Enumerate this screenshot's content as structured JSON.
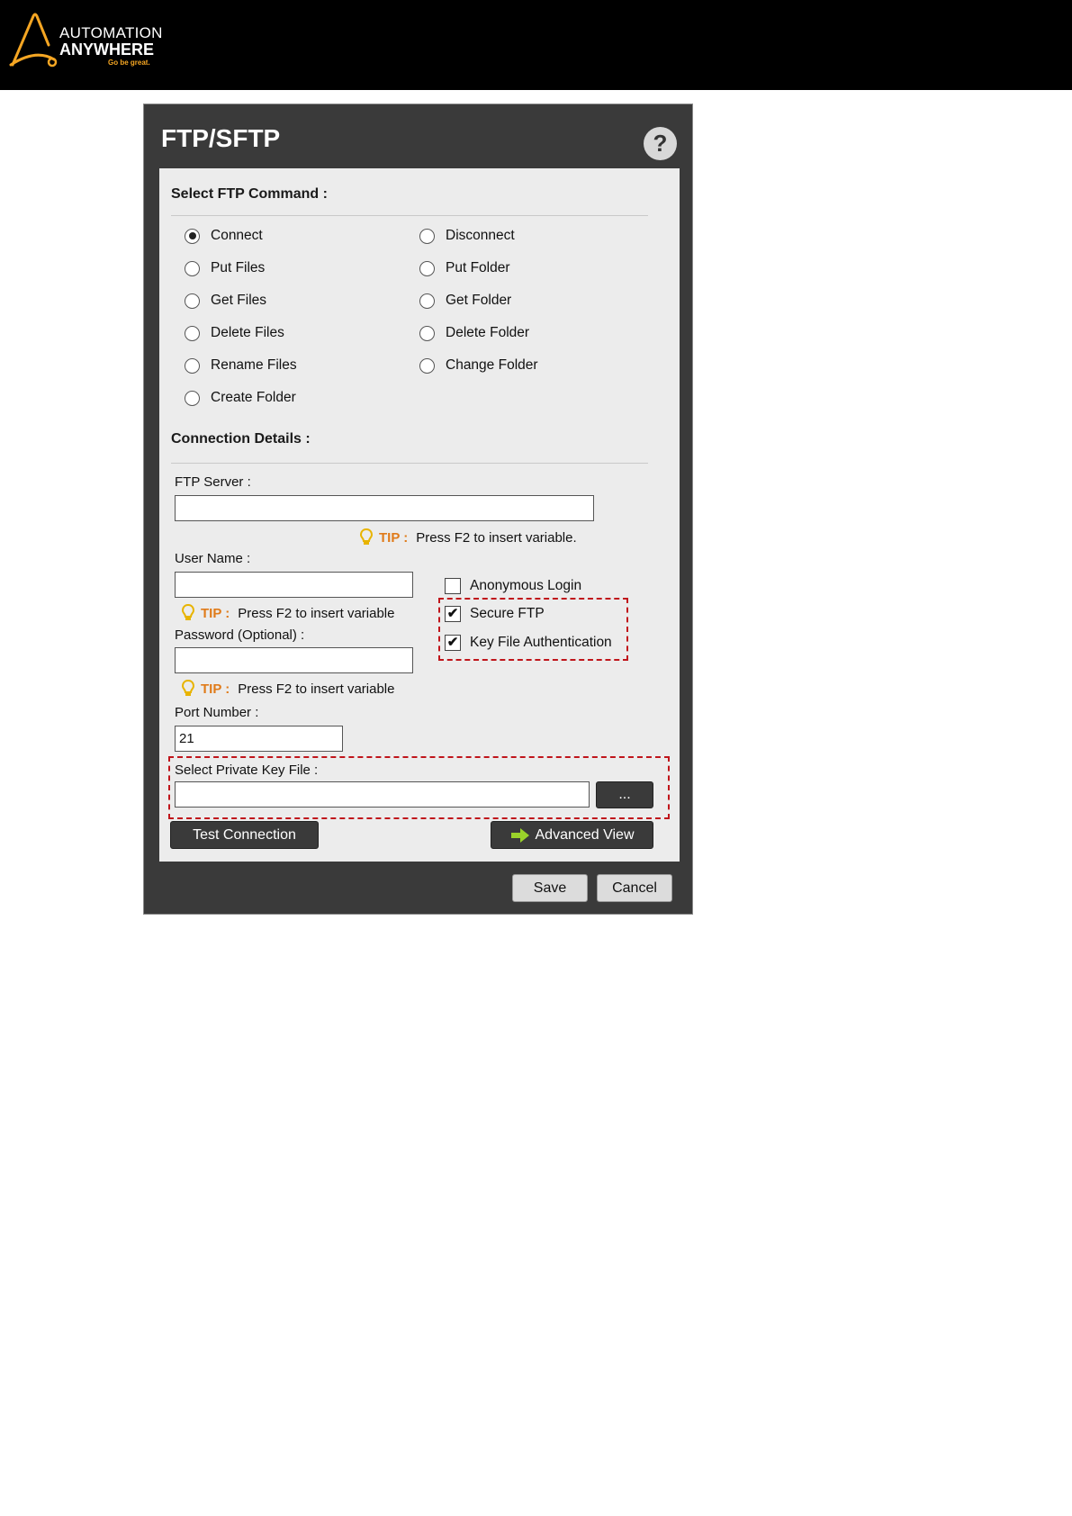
{
  "brand": {
    "line1": "AUTOMATION",
    "line2": "ANYWHERE",
    "tagline": "Go be great."
  },
  "dialog": {
    "title": "FTP/SFTP",
    "help_label": "?"
  },
  "command_section": {
    "heading": "Select FTP Command :",
    "options": [
      {
        "label": "Connect",
        "selected": true
      },
      {
        "label": "Disconnect",
        "selected": false
      },
      {
        "label": "Put Files",
        "selected": false
      },
      {
        "label": "Put Folder",
        "selected": false
      },
      {
        "label": "Get Files",
        "selected": false
      },
      {
        "label": "Get Folder",
        "selected": false
      },
      {
        "label": "Delete Files",
        "selected": false
      },
      {
        "label": "Delete Folder",
        "selected": false
      },
      {
        "label": "Rename Files",
        "selected": false
      },
      {
        "label": "Change Folder",
        "selected": false
      },
      {
        "label": "Create Folder",
        "selected": false
      }
    ]
  },
  "connection": {
    "heading": "Connection Details :",
    "ftp_server_label": "FTP Server :",
    "ftp_server_value": "",
    "tip_label": "TIP :",
    "tip_server_text": "Press F2 to insert variable.",
    "user_name_label": "User Name :",
    "user_name_value": "",
    "tip_user_text": "Press F2 to insert variable",
    "password_label": "Password (Optional) :",
    "password_value": "",
    "tip_password_text": "Press F2 to insert variable",
    "port_label": "Port Number :",
    "port_value": "21",
    "key_file_label": "Select Private Key File :",
    "key_file_value": "",
    "browse_label": "...",
    "anonymous_label": "Anonymous Login",
    "anonymous_checked": false,
    "secure_label": "Secure FTP",
    "secure_checked": true,
    "keyauth_label": "Key File Authentication",
    "keyauth_checked": true,
    "test_label": "Test Connection",
    "advanced_label": "Advanced View"
  },
  "footer": {
    "save_label": "Save",
    "cancel_label": "Cancel"
  },
  "colors": {
    "dialog_bg": "#3a3a3a",
    "panel_bg": "#ececec",
    "tip_color": "#e07b1a",
    "highlight_dash": "#c0151b",
    "brand_accent": "#f5a623"
  }
}
